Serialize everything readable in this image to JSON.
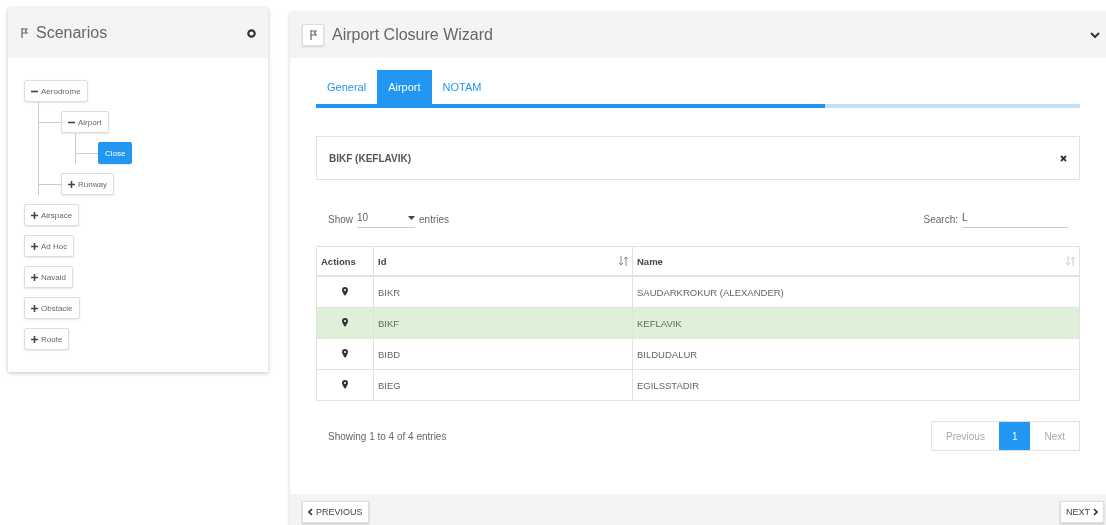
{
  "scenarios": {
    "title": "Scenarios",
    "tree": [
      {
        "label": "Aerodrome",
        "expanded": true,
        "selected": false,
        "children": [
          {
            "label": "Airport",
            "expanded": true,
            "selected": false,
            "children": [
              {
                "label": "Close",
                "selected": true
              }
            ]
          },
          {
            "label": "Runway",
            "expanded": false,
            "selected": false
          }
        ]
      },
      {
        "label": "Airspace",
        "expanded": false,
        "selected": false
      },
      {
        "label": "Ad Hoc",
        "expanded": false,
        "selected": false
      },
      {
        "label": "Navaid",
        "expanded": false,
        "selected": false
      },
      {
        "label": "Obstacle",
        "expanded": false,
        "selected": false
      },
      {
        "label": "Route",
        "expanded": false,
        "selected": false
      }
    ]
  },
  "wizard": {
    "title": "Airport Closure Wizard",
    "tabs": [
      {
        "label": "General",
        "selected": false
      },
      {
        "label": "Airport",
        "selected": true
      },
      {
        "label": "NOTAM",
        "selected": false
      }
    ],
    "progress": {
      "level": 0.666
    },
    "selection": {
      "text": "BIKF (KEFLAVIK)"
    },
    "length": {
      "show": "Show",
      "value": "10",
      "entries": "entries"
    },
    "search": {
      "label": "Search:",
      "value": "L"
    },
    "table": {
      "columns": [
        "Actions",
        "Id",
        "Name"
      ],
      "rows": [
        {
          "id": "BIKR",
          "name": "SAUDARKROKUR (ALEXANDER)",
          "selected": false
        },
        {
          "id": "BIKF",
          "name": "KEFLAVIK",
          "selected": true
        },
        {
          "id": "BIBD",
          "name": "BILDUDALUR",
          "selected": false
        },
        {
          "id": "BIEG",
          "name": "EGILSSTADIR",
          "selected": false
        }
      ]
    },
    "info": "Showing 1 to 4 of 4 entries",
    "pagination": [
      {
        "label": "Previous",
        "selected": false,
        "disabled": true
      },
      {
        "label": "1",
        "selected": true,
        "disabled": false
      },
      {
        "label": "Next",
        "selected": false,
        "disabled": true
      }
    ],
    "footer": {
      "previous": "PREVIOUS",
      "next": "NEXT"
    }
  }
}
